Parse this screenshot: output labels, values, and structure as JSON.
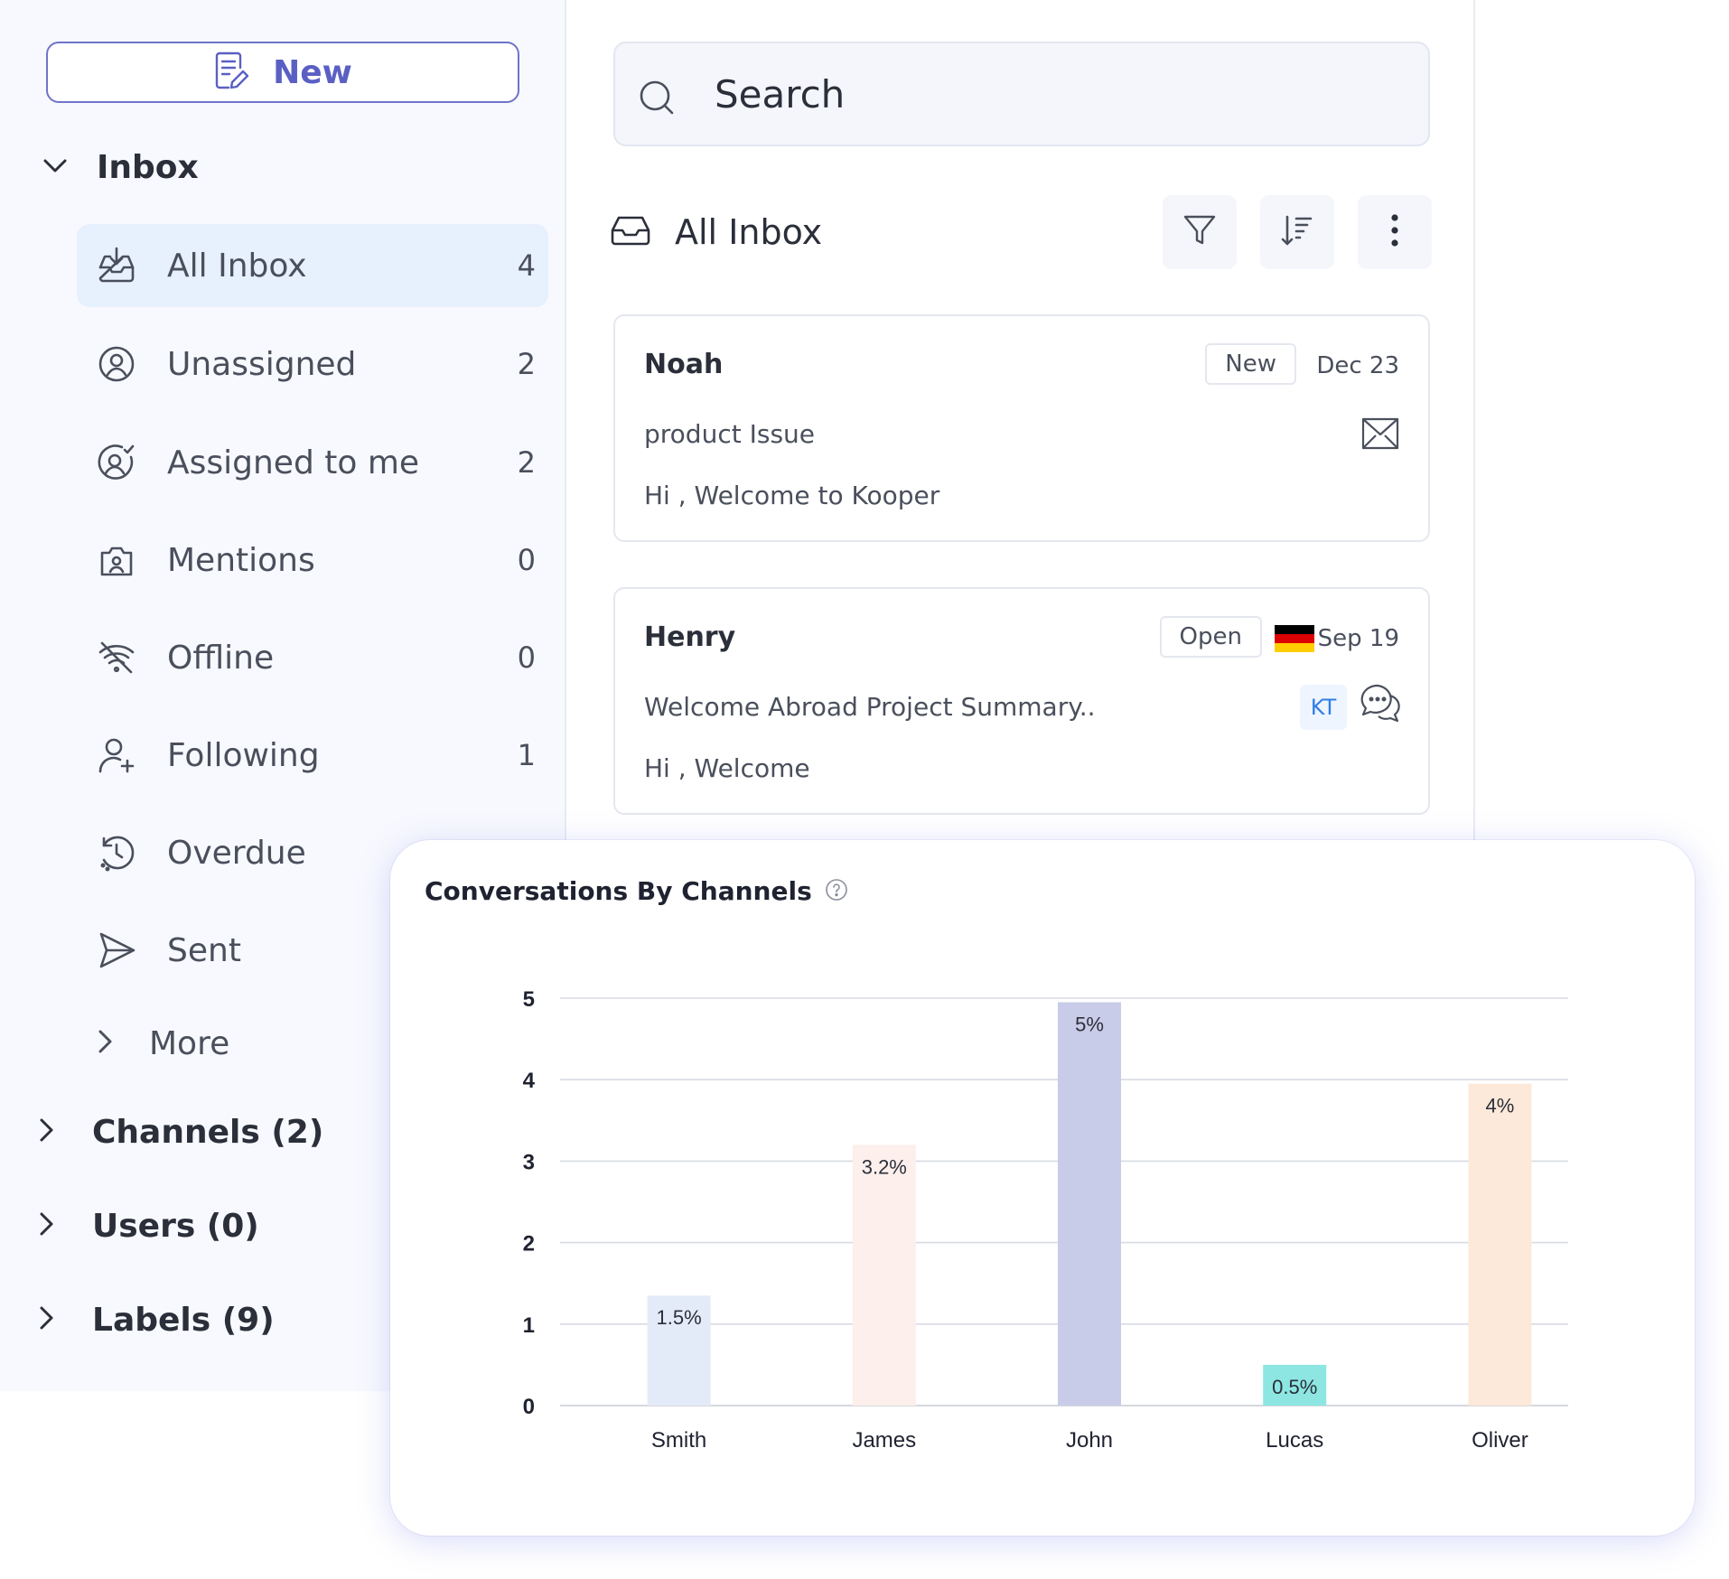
{
  "sidebar": {
    "new_label": "New",
    "inbox_label": "Inbox",
    "items": [
      {
        "label": "All Inbox",
        "count": "4",
        "icon": "inbox-download-icon"
      },
      {
        "label": "Unassigned",
        "count": "2",
        "icon": "user-circle-icon"
      },
      {
        "label": "Assigned to me",
        "count": "2",
        "icon": "user-check-circle-icon"
      },
      {
        "label": "Mentions",
        "count": "0",
        "icon": "camera-user-icon"
      },
      {
        "label": "Offline",
        "count": "0",
        "icon": "wifi-off-icon"
      },
      {
        "label": "Following",
        "count": "1",
        "icon": "user-plus-icon"
      },
      {
        "label": "Overdue",
        "count": "",
        "icon": "clock-history-icon"
      },
      {
        "label": "Sent",
        "count": "",
        "icon": "send-icon"
      }
    ],
    "more_label": "More",
    "groups": [
      {
        "label": "Channels (2)"
      },
      {
        "label": "Users (0)"
      },
      {
        "label": "Labels (9)"
      }
    ]
  },
  "middle": {
    "search_placeholder": "Search",
    "list_title": "All Inbox",
    "conversations": [
      {
        "name": "Noah",
        "status": "New",
        "date": "Dec 23",
        "subject": "product Issue",
        "preview": "Hi , Welcome to Kooper",
        "channel_icon": "envelope-icon"
      },
      {
        "name": "Henry",
        "status": "Open",
        "date": "Sep 19",
        "subject": "Welcome Abroad Project Summary..",
        "preview": "Hi , Welcome",
        "assignee": "KT",
        "channel_icon": "chat-bubbles-icon",
        "flag": "germany-flag"
      }
    ]
  },
  "colors": {
    "accent": "#5a60c3",
    "active_bg": "#e7f0fd",
    "kt_blue": "#2f7ee6"
  },
  "chart": {
    "title": "Conversations By Channels"
  },
  "chart_data": {
    "type": "bar",
    "title": "Conversations By Channels",
    "categories": [
      "Smith",
      "James",
      "John",
      "Lucas",
      "Oliver"
    ],
    "values": [
      1.35,
      3.2,
      4.95,
      0.5,
      3.95
    ],
    "data_labels": [
      "1.5%",
      "3.2%",
      "5%",
      "0.5%",
      "4%"
    ],
    "bar_colors": [
      "#e3ebf9",
      "#fcefec",
      "#c9cce8",
      "#8de6e1",
      "#fde9d9"
    ],
    "yticks": [
      "0",
      "1",
      "2",
      "3",
      "4",
      "5"
    ],
    "ylim": [
      0,
      5
    ],
    "xlabel": "",
    "ylabel": "",
    "grid": true
  }
}
